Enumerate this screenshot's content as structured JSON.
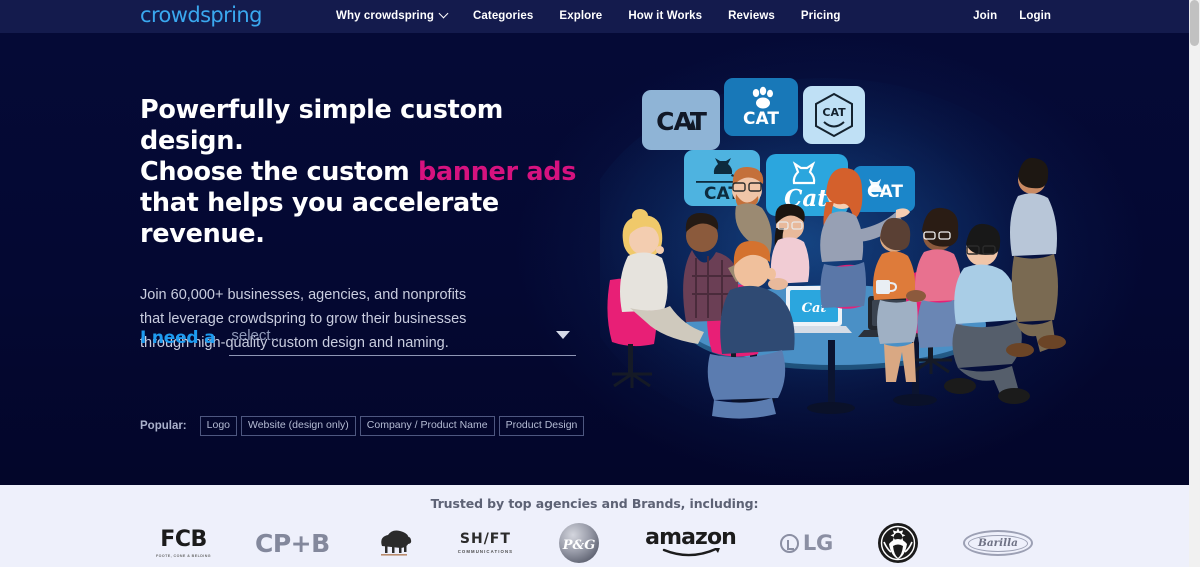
{
  "brand": {
    "logo_text": "crowdspring",
    "logo_color": "#3aa8ef"
  },
  "header": {
    "nav": [
      {
        "label": "Why crowdspring",
        "has_caret": true
      },
      {
        "label": "Categories",
        "has_caret": false
      },
      {
        "label": "Explore",
        "has_caret": false
      },
      {
        "label": "How it Works",
        "has_caret": false
      },
      {
        "label": "Reviews",
        "has_caret": false
      },
      {
        "label": "Pricing",
        "has_caret": false
      }
    ],
    "actions": [
      {
        "label": "Join"
      },
      {
        "label": "Login"
      }
    ],
    "background": "#141b4d"
  },
  "hero": {
    "headline_line1": "Powerfully simple custom design.",
    "headline_line2_prefix": "Choose the custom ",
    "headline_line2_accent": "banner ads",
    "headline_line3": "that helps you accelerate revenue.",
    "accent_color": "#d6127f",
    "subcopy_line1": "Join 60,000+ businesses, agencies, and nonprofits",
    "subcopy_line2": "that leverage crowdspring to grow their businesses",
    "subcopy_line3": "through high-quality custom design and naming.",
    "need_label": "I need a",
    "need_label_color": "#1e9bf0",
    "select_placeholder": "select...",
    "select_value": "select...",
    "dropdown_icon": "chevron-down-icon",
    "popular_label": "Popular:",
    "popular_tags": [
      "Logo",
      "Website (design only)",
      "Company / Product Name",
      "Product Design"
    ],
    "background": "#040832"
  },
  "illustration": {
    "name": "team-collaboration-illustration",
    "description": "Team seated around a conference table reviewing CAT logo design concepts",
    "cards": [
      {
        "text": "CAT",
        "style": "wordmark",
        "bg": "#8fb4d6",
        "fg": "#111827"
      },
      {
        "text": "CAT",
        "style": "paw-above",
        "bg": "#1878b8",
        "fg": "#ffffff"
      },
      {
        "text": "CAT",
        "style": "hexagon-badge",
        "bg": "#bfe0f5",
        "fg": "#14222e"
      },
      {
        "text": "CAT",
        "style": "cat-silhouette",
        "bg": "#4eb3e0",
        "fg": "#0d2b3e"
      },
      {
        "text": "Cat",
        "style": "script",
        "bg": "#2ba6de",
        "fg": "#ffffff"
      },
      {
        "text": "CAT",
        "style": "cat-mark",
        "bg": "#1b86c9",
        "fg": "#ffffff"
      }
    ],
    "chair_color": "#e81f76",
    "table_color": "#2f6f9e"
  },
  "trusted": {
    "title": "Trusted by top agencies and Brands, including:",
    "background": "#eef0fb",
    "brands": [
      {
        "name": "FCB",
        "text": "FCB",
        "subtext": "FOOTE, CONE & BELDING"
      },
      {
        "name": "CP+B",
        "text": "CP+B",
        "subtext": ""
      },
      {
        "name": "Sheep logo",
        "text": "",
        "subtext": ""
      },
      {
        "name": "SHIFT Communications",
        "text": "SH/FT",
        "subtext": "COMMUNICATIONS"
      },
      {
        "name": "P&G",
        "text": "P&G",
        "subtext": ""
      },
      {
        "name": "amazon",
        "text": "amazon",
        "subtext": ""
      },
      {
        "name": "LG",
        "text": "LG",
        "subtext": ""
      },
      {
        "name": "Starbucks",
        "text": "",
        "subtext": ""
      },
      {
        "name": "Barilla",
        "text": "Barilla",
        "subtext": ""
      }
    ]
  },
  "scrollbar": {
    "name": "page-scrollbar",
    "position": "right"
  }
}
